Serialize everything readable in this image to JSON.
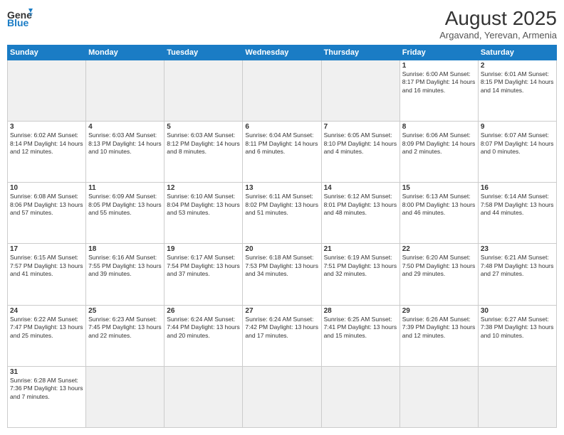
{
  "header": {
    "logo_general": "General",
    "logo_blue": "Blue",
    "month": "August 2025",
    "location": "Argavand, Yerevan, Armenia"
  },
  "days_of_week": [
    "Sunday",
    "Monday",
    "Tuesday",
    "Wednesday",
    "Thursday",
    "Friday",
    "Saturday"
  ],
  "weeks": [
    [
      {
        "day": "",
        "info": ""
      },
      {
        "day": "",
        "info": ""
      },
      {
        "day": "",
        "info": ""
      },
      {
        "day": "",
        "info": ""
      },
      {
        "day": "",
        "info": ""
      },
      {
        "day": "1",
        "info": "Sunrise: 6:00 AM\nSunset: 8:17 PM\nDaylight: 14 hours and 16 minutes."
      },
      {
        "day": "2",
        "info": "Sunrise: 6:01 AM\nSunset: 8:15 PM\nDaylight: 14 hours and 14 minutes."
      }
    ],
    [
      {
        "day": "3",
        "info": "Sunrise: 6:02 AM\nSunset: 8:14 PM\nDaylight: 14 hours and 12 minutes."
      },
      {
        "day": "4",
        "info": "Sunrise: 6:03 AM\nSunset: 8:13 PM\nDaylight: 14 hours and 10 minutes."
      },
      {
        "day": "5",
        "info": "Sunrise: 6:03 AM\nSunset: 8:12 PM\nDaylight: 14 hours and 8 minutes."
      },
      {
        "day": "6",
        "info": "Sunrise: 6:04 AM\nSunset: 8:11 PM\nDaylight: 14 hours and 6 minutes."
      },
      {
        "day": "7",
        "info": "Sunrise: 6:05 AM\nSunset: 8:10 PM\nDaylight: 14 hours and 4 minutes."
      },
      {
        "day": "8",
        "info": "Sunrise: 6:06 AM\nSunset: 8:09 PM\nDaylight: 14 hours and 2 minutes."
      },
      {
        "day": "9",
        "info": "Sunrise: 6:07 AM\nSunset: 8:07 PM\nDaylight: 14 hours and 0 minutes."
      }
    ],
    [
      {
        "day": "10",
        "info": "Sunrise: 6:08 AM\nSunset: 8:06 PM\nDaylight: 13 hours and 57 minutes."
      },
      {
        "day": "11",
        "info": "Sunrise: 6:09 AM\nSunset: 8:05 PM\nDaylight: 13 hours and 55 minutes."
      },
      {
        "day": "12",
        "info": "Sunrise: 6:10 AM\nSunset: 8:04 PM\nDaylight: 13 hours and 53 minutes."
      },
      {
        "day": "13",
        "info": "Sunrise: 6:11 AM\nSunset: 8:02 PM\nDaylight: 13 hours and 51 minutes."
      },
      {
        "day": "14",
        "info": "Sunrise: 6:12 AM\nSunset: 8:01 PM\nDaylight: 13 hours and 48 minutes."
      },
      {
        "day": "15",
        "info": "Sunrise: 6:13 AM\nSunset: 8:00 PM\nDaylight: 13 hours and 46 minutes."
      },
      {
        "day": "16",
        "info": "Sunrise: 6:14 AM\nSunset: 7:58 PM\nDaylight: 13 hours and 44 minutes."
      }
    ],
    [
      {
        "day": "17",
        "info": "Sunrise: 6:15 AM\nSunset: 7:57 PM\nDaylight: 13 hours and 41 minutes."
      },
      {
        "day": "18",
        "info": "Sunrise: 6:16 AM\nSunset: 7:55 PM\nDaylight: 13 hours and 39 minutes."
      },
      {
        "day": "19",
        "info": "Sunrise: 6:17 AM\nSunset: 7:54 PM\nDaylight: 13 hours and 37 minutes."
      },
      {
        "day": "20",
        "info": "Sunrise: 6:18 AM\nSunset: 7:53 PM\nDaylight: 13 hours and 34 minutes."
      },
      {
        "day": "21",
        "info": "Sunrise: 6:19 AM\nSunset: 7:51 PM\nDaylight: 13 hours and 32 minutes."
      },
      {
        "day": "22",
        "info": "Sunrise: 6:20 AM\nSunset: 7:50 PM\nDaylight: 13 hours and 29 minutes."
      },
      {
        "day": "23",
        "info": "Sunrise: 6:21 AM\nSunset: 7:48 PM\nDaylight: 13 hours and 27 minutes."
      }
    ],
    [
      {
        "day": "24",
        "info": "Sunrise: 6:22 AM\nSunset: 7:47 PM\nDaylight: 13 hours and 25 minutes."
      },
      {
        "day": "25",
        "info": "Sunrise: 6:23 AM\nSunset: 7:45 PM\nDaylight: 13 hours and 22 minutes."
      },
      {
        "day": "26",
        "info": "Sunrise: 6:24 AM\nSunset: 7:44 PM\nDaylight: 13 hours and 20 minutes."
      },
      {
        "day": "27",
        "info": "Sunrise: 6:24 AM\nSunset: 7:42 PM\nDaylight: 13 hours and 17 minutes."
      },
      {
        "day": "28",
        "info": "Sunrise: 6:25 AM\nSunset: 7:41 PM\nDaylight: 13 hours and 15 minutes."
      },
      {
        "day": "29",
        "info": "Sunrise: 6:26 AM\nSunset: 7:39 PM\nDaylight: 13 hours and 12 minutes."
      },
      {
        "day": "30",
        "info": "Sunrise: 6:27 AM\nSunset: 7:38 PM\nDaylight: 13 hours and 10 minutes."
      }
    ],
    [
      {
        "day": "31",
        "info": "Sunrise: 6:28 AM\nSunset: 7:36 PM\nDaylight: 13 hours and 7 minutes."
      },
      {
        "day": "",
        "info": ""
      },
      {
        "day": "",
        "info": ""
      },
      {
        "day": "",
        "info": ""
      },
      {
        "day": "",
        "info": ""
      },
      {
        "day": "",
        "info": ""
      },
      {
        "day": "",
        "info": ""
      }
    ]
  ]
}
